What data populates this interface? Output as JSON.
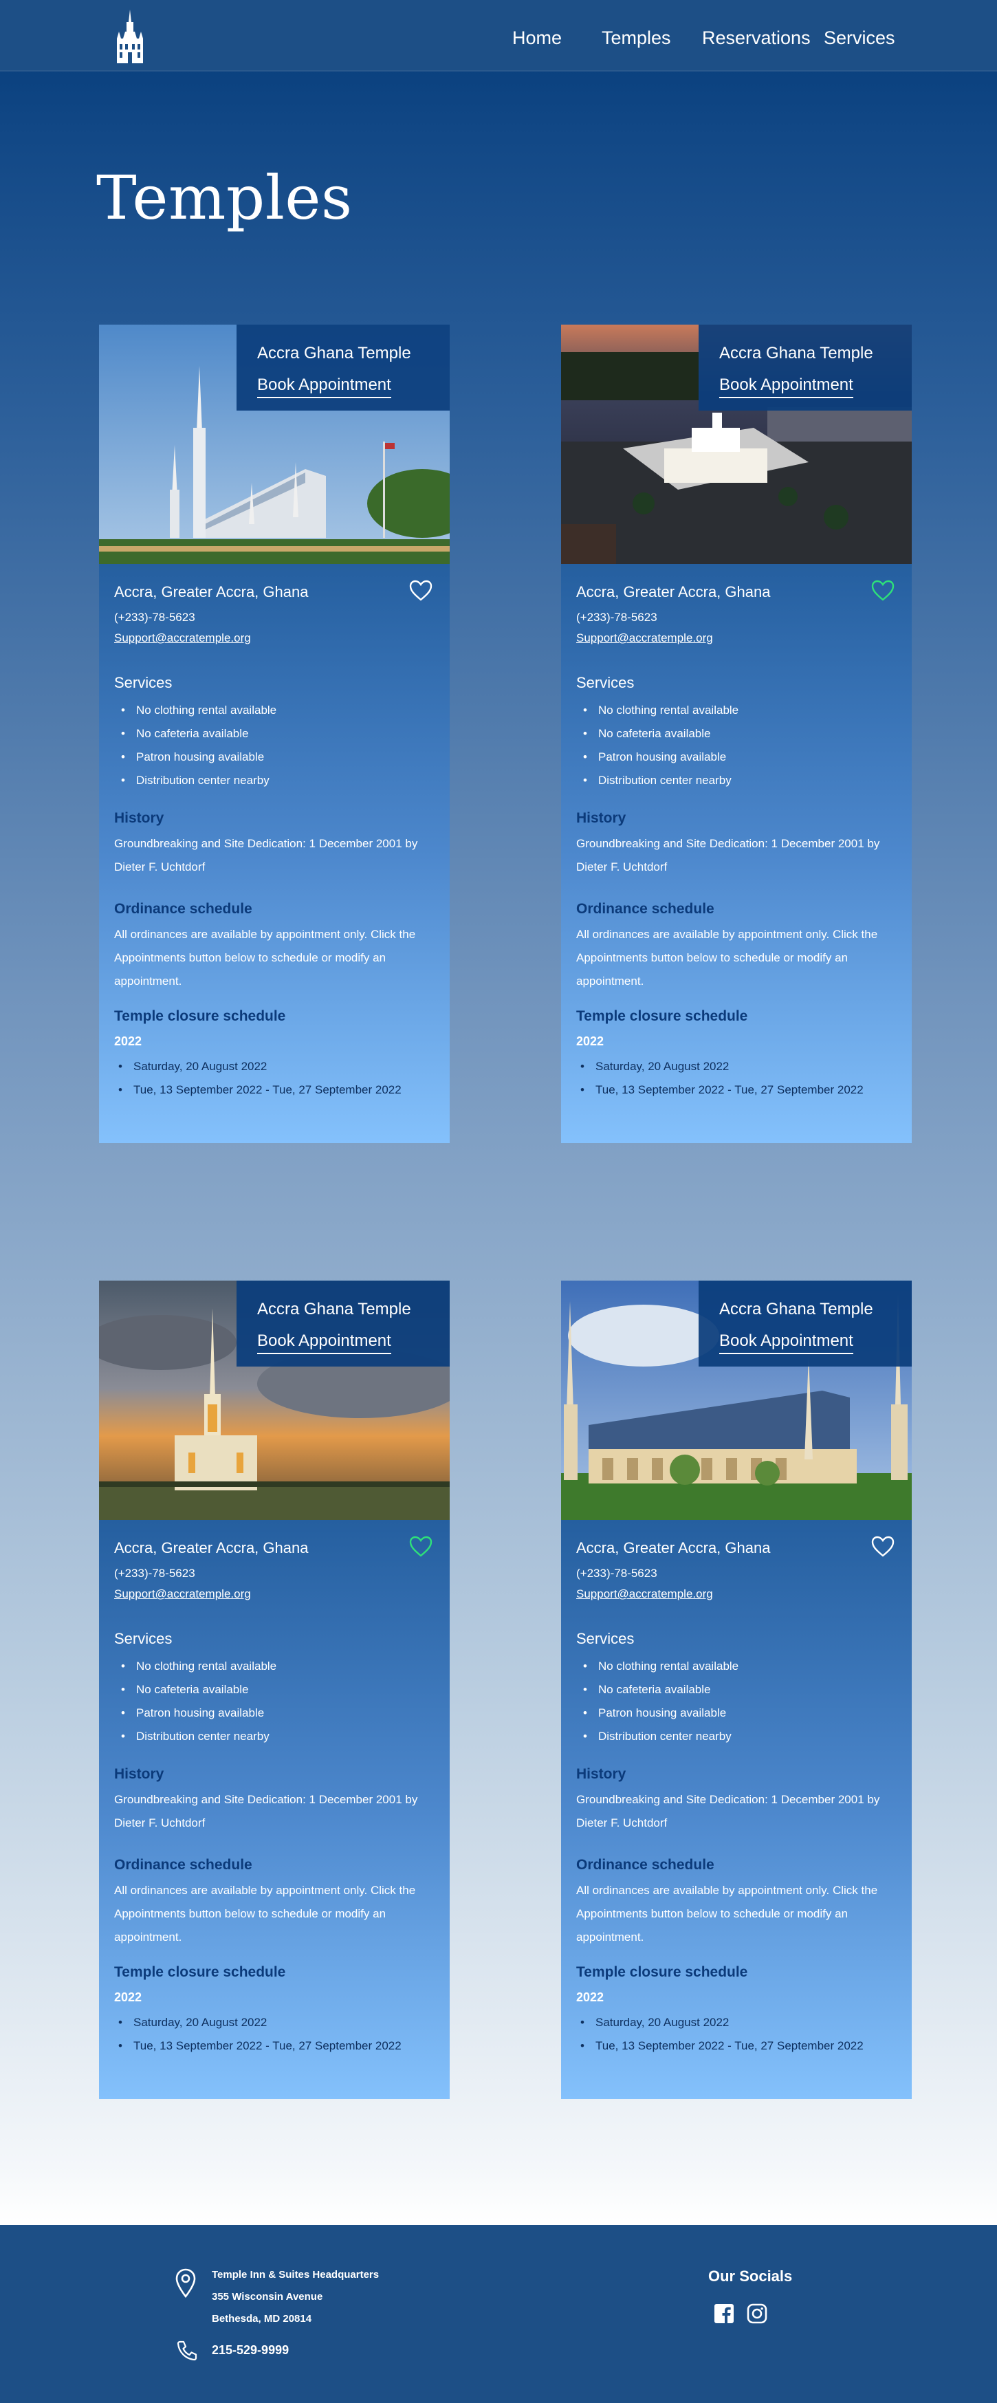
{
  "nav": {
    "home": "Home",
    "temples": "Temples",
    "reservations": "Reservations",
    "services": "Services",
    "logo_icon": "temple-logo-icon"
  },
  "page": {
    "title": "Temples"
  },
  "cards": [
    {
      "overlay_title": "Accra Ghana Temple",
      "book_label": "Book Appointment",
      "location": "Accra, Greater Accra, Ghana",
      "phone": "(+233)-78-5623",
      "email": "Support@accratemple.org",
      "favorited": false,
      "services_heading": "Services",
      "services": [
        "No clothing rental available",
        "No cafeteria available",
        "Patron housing available",
        "Distribution center nearby"
      ],
      "history_heading": "History",
      "history_text": "Groundbreaking and Site Dedication: 1 December 2001 by Dieter F. Uchtdorf",
      "ordinance_heading": "Ordinance schedule",
      "ordinance_text": "All ordinances are available by appointment only. Click the Appointments button below to schedule or modify an appointment.",
      "closure_heading": "Temple closure schedule",
      "closure_year": "2022",
      "closures": [
        "Saturday, 20 August 2022",
        "Tue, 13 September 2022 - Tue, 27 September 2022"
      ]
    },
    {
      "overlay_title": "Accra Ghana Temple",
      "book_label": "Book Appointment",
      "location": "Accra, Greater Accra, Ghana",
      "phone": "(+233)-78-5623",
      "email": "Support@accratemple.org",
      "favorited": true,
      "services_heading": "Services",
      "services": [
        "No clothing rental available",
        "No cafeteria available",
        "Patron housing available",
        "Distribution center nearby"
      ],
      "history_heading": "History",
      "history_text": "Groundbreaking and Site Dedication: 1 December 2001 by Dieter F. Uchtdorf",
      "ordinance_heading": "Ordinance schedule",
      "ordinance_text": "All ordinances are available by appointment only. Click the Appointments button below to schedule or modify an appointment.",
      "closure_heading": "Temple closure schedule",
      "closure_year": "2022",
      "closures": [
        "Saturday, 20 August 2022",
        "Tue, 13 September 2022 - Tue, 27 September 2022"
      ]
    },
    {
      "overlay_title": "Accra Ghana Temple",
      "book_label": "Book Appointment",
      "location": "Accra, Greater Accra, Ghana",
      "phone": "(+233)-78-5623",
      "email": "Support@accratemple.org",
      "favorited": true,
      "services_heading": "Services",
      "services": [
        "No clothing rental available",
        "No cafeteria available",
        "Patron housing available",
        "Distribution center nearby"
      ],
      "history_heading": "History",
      "history_text": "Groundbreaking and Site Dedication: 1 December 2001 by Dieter F. Uchtdorf",
      "ordinance_heading": "Ordinance schedule",
      "ordinance_text": "All ordinances are available by appointment only. Click the Appointments button below to schedule or modify an appointment.",
      "closure_heading": "Temple closure schedule",
      "closure_year": "2022",
      "closures": [
        "Saturday, 20 August 2022",
        "Tue, 13 September 2022 - Tue, 27 September 2022"
      ]
    },
    {
      "overlay_title": "Accra Ghana Temple",
      "book_label": "Book Appointment",
      "location": "Accra, Greater Accra, Ghana",
      "phone": "(+233)-78-5623",
      "email": "Support@accratemple.org",
      "favorited": false,
      "services_heading": "Services",
      "services": [
        "No clothing rental available",
        "No cafeteria available",
        "Patron housing available",
        "Distribution center nearby"
      ],
      "history_heading": "History",
      "history_text": "Groundbreaking and Site Dedication: 1 December 2001 by Dieter F. Uchtdorf",
      "ordinance_heading": "Ordinance schedule",
      "ordinance_text": "All ordinances are available by appointment only. Click the Appointments button below to schedule or modify an appointment.",
      "closure_heading": "Temple closure schedule",
      "closure_year": "2022",
      "closures": [
        "Saturday, 20 August 2022",
        "Tue, 13 September 2022 - Tue, 27 September 2022"
      ]
    }
  ],
  "footer": {
    "address_name": "Temple Inn & Suites Headquarters",
    "address_street": "355 Wisconsin Avenue",
    "address_city": "Bethesda, MD 20814",
    "phone": "215-529-9999",
    "socials_heading": "Our Socials",
    "social_icons": [
      "facebook-icon",
      "instagram-icon"
    ]
  },
  "colors": {
    "heart_favorited": "#2ee07a",
    "heart_default": "#ffffff",
    "section_heading": "#0b3a7a",
    "footer_bg": "#1d4f86"
  }
}
